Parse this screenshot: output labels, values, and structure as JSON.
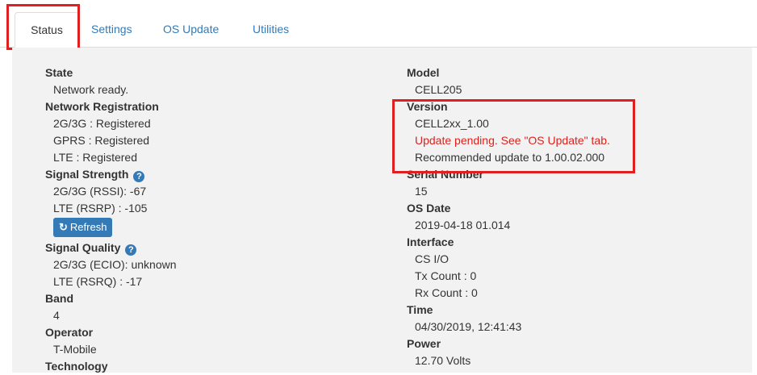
{
  "tabs": [
    "Status",
    "Settings",
    "OS Update",
    "Utilities"
  ],
  "left": {
    "state_label": "State",
    "state_value": "Network ready.",
    "netreg_label": "Network Registration",
    "netreg_values": [
      "2G/3G : Registered",
      "GPRS : Registered",
      "LTE : Registered"
    ],
    "signal_strength_label": "Signal Strength",
    "signal_strength_values": [
      "2G/3G (RSSI): -67",
      "LTE (RSRP) : -105"
    ],
    "refresh_label": "Refresh",
    "signal_quality_label": "Signal Quality",
    "signal_quality_values": [
      "2G/3G (ECIO): unknown",
      "LTE (RSRQ) : -17"
    ],
    "band_label": "Band",
    "band_value": "4",
    "operator_label": "Operator",
    "operator_value": "T-Mobile",
    "technology_label": "Technology"
  },
  "right": {
    "model_label": "Model",
    "model_value": "CELL205",
    "version_label": "Version",
    "version_value": "CELL2xx_1.00",
    "version_warning": "Update pending. See \"OS Update\" tab.",
    "version_recommend": "Recommended update to 1.00.02.000",
    "serial_label": "Serial Number",
    "serial_value": "15",
    "osdate_label": "OS Date",
    "osdate_value": "2019-04-18 01.014",
    "interface_label": "Interface",
    "interface_values": [
      "CS I/O",
      "Tx Count : 0",
      "Rx Count : 0"
    ],
    "time_label": "Time",
    "time_value": "04/30/2019, 12:41:43",
    "power_label": "Power",
    "power_value": "12.70 Volts"
  },
  "icons": {
    "help": "question-circle-icon",
    "refresh": "refresh-icon"
  },
  "colors": {
    "link": "#337ab7",
    "warning": "#e0201b",
    "highlight": "#e02020",
    "panel": "#f2f2f2"
  }
}
